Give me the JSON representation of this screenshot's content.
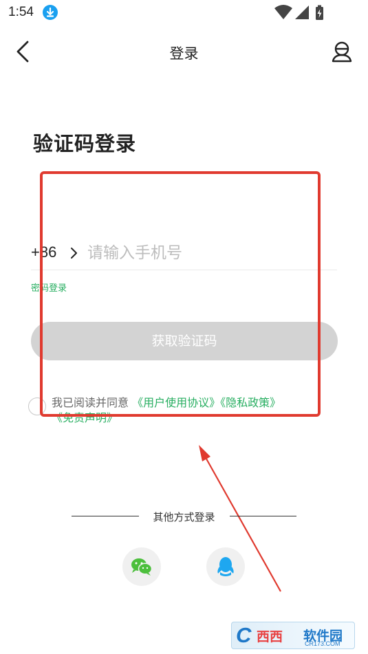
{
  "status_bar": {
    "time": "1:54",
    "download_icon": "download-icon",
    "wifi_icon": "wifi-icon",
    "signal_icon": "signal-icon",
    "battery_icon": "battery-charging-icon"
  },
  "nav": {
    "back_icon": "back-arrow-icon",
    "title": "登录",
    "service_icon": "customer-service-icon"
  },
  "heading": "验证码登录",
  "phone": {
    "country_code": "+86",
    "placeholder": "请输入手机号",
    "value": ""
  },
  "password_login_link": "密码登录",
  "get_code_button": "获取验证码",
  "agreement": {
    "checked": false,
    "prefix": "我已阅读并同意",
    "user_agreement": "《用户使用协议》",
    "privacy_policy": "《隐私政策》",
    "disclaimer": "《免责声明》"
  },
  "other_login": {
    "label": "其他方式登录",
    "methods": [
      {
        "icon": "wechat-icon"
      },
      {
        "icon": "qq-icon"
      }
    ]
  },
  "colors": {
    "accent_green": "#27ae60",
    "button_disabled": "#d3d3d3",
    "annotation_red": "#e03a2f",
    "wechat_green": "#4cbf3c",
    "qq_blue": "#1ea7f0"
  },
  "watermark": {
    "logo_letter": "C",
    "brand_red": "西西",
    "brand_blue": "软件园",
    "domain": "CR173.COM"
  }
}
